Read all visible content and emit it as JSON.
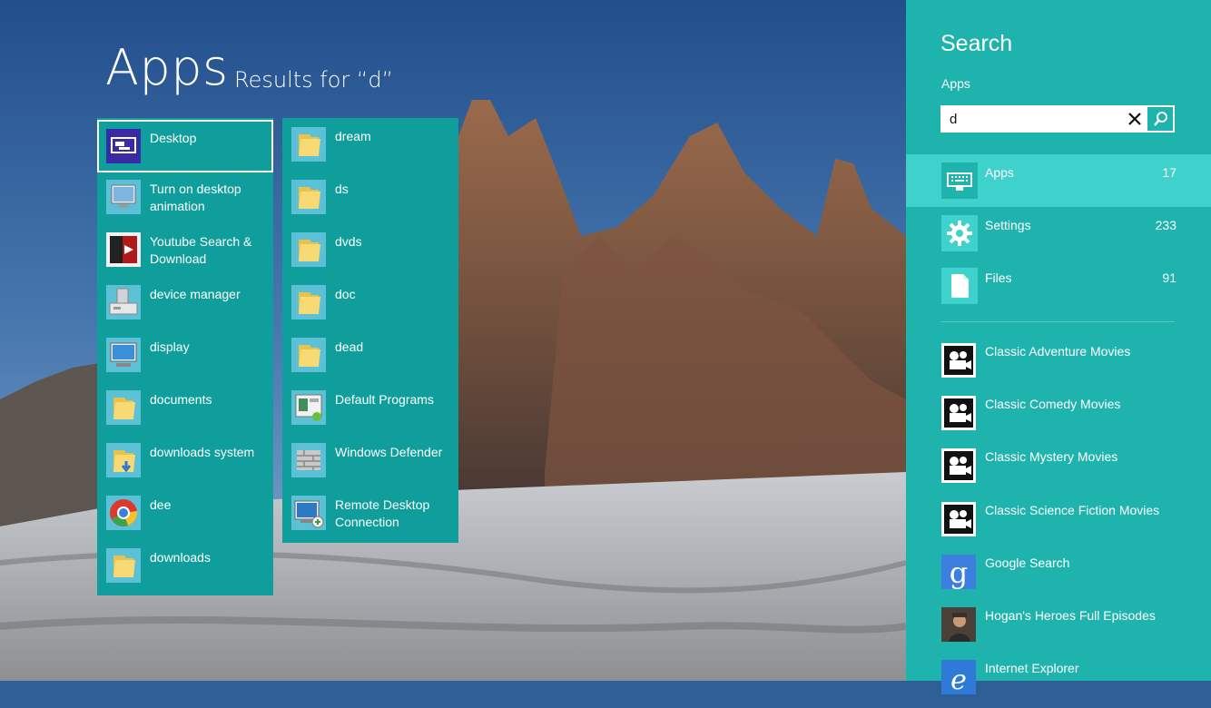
{
  "page": {
    "title": "Apps",
    "subtitle": "Results for “d”"
  },
  "results": {
    "column1": [
      {
        "label": "Desktop",
        "icon": "desktop-icon",
        "selected": true
      },
      {
        "label": "Turn on desktop animation",
        "icon": "monitor-icon"
      },
      {
        "label": "Youtube Search & Download",
        "icon": "youtube-app-icon"
      },
      {
        "label": "device manager",
        "icon": "device-manager-icon"
      },
      {
        "label": "display",
        "icon": "display-icon"
      },
      {
        "label": "documents",
        "icon": "folder-icon"
      },
      {
        "label": "downloads system",
        "icon": "download-folder-icon"
      },
      {
        "label": "dee",
        "icon": "chrome-icon"
      },
      {
        "label": "downloads",
        "icon": "folder-icon"
      }
    ],
    "column2": [
      {
        "label": "dream",
        "icon": "folder-icon"
      },
      {
        "label": "ds",
        "icon": "folder-icon"
      },
      {
        "label": "dvds",
        "icon": "folder-icon"
      },
      {
        "label": "doc",
        "icon": "folder-icon"
      },
      {
        "label": "dead",
        "icon": "folder-icon"
      },
      {
        "label": "Default Programs",
        "icon": "default-programs-icon"
      },
      {
        "label": "Windows Defender",
        "icon": "windows-defender-icon"
      },
      {
        "label": "Remote Desktop Connection",
        "icon": "remote-desktop-icon"
      }
    ]
  },
  "search": {
    "title": "Search",
    "scope": "Apps",
    "query": "d",
    "categories": [
      {
        "label": "Apps",
        "count": "17",
        "icon": "apps-keyboard-icon",
        "active": true
      },
      {
        "label": "Settings",
        "count": "233",
        "icon": "gear-icon"
      },
      {
        "label": "Files",
        "count": "91",
        "icon": "file-icon"
      }
    ],
    "apps": [
      {
        "label": "Classic Adventure Movies",
        "icon": "movie-camera-icon"
      },
      {
        "label": "Classic Comedy Movies",
        "icon": "movie-camera-icon"
      },
      {
        "label": "Classic Mystery Movies",
        "icon": "movie-camera-icon"
      },
      {
        "label": "Classic Science Fiction Movies",
        "icon": "movie-camera-icon"
      },
      {
        "label": "Google Search",
        "icon": "google-search-icon"
      },
      {
        "label": "Hogan's Heroes Full Episodes",
        "icon": "hogans-heroes-icon"
      },
      {
        "label": "Internet Explorer",
        "icon": "internet-explorer-icon"
      }
    ]
  },
  "colors": {
    "tile_bg": "#0f9e9b",
    "charm_bg": "#1fb3ad",
    "charm_active": "#3fd1cc",
    "sky": "#2f5f97"
  }
}
